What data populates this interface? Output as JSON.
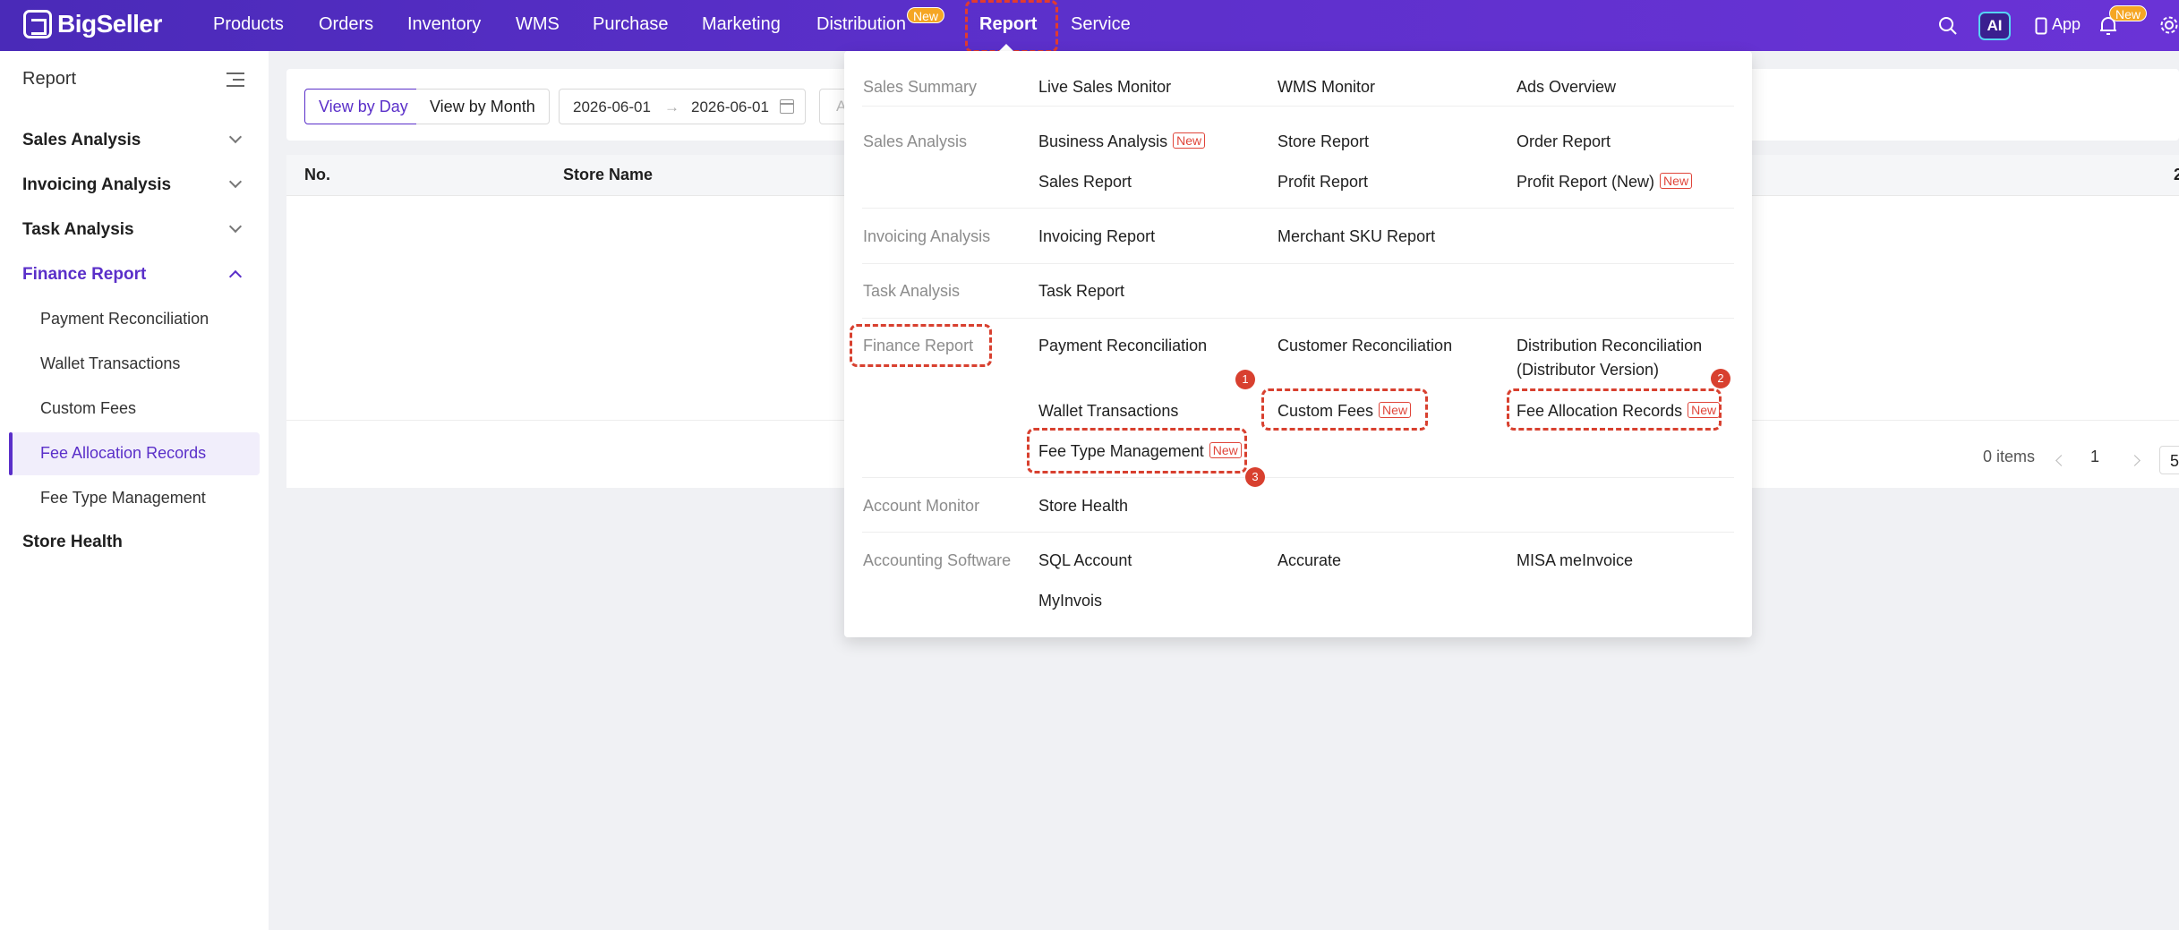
{
  "brand": {
    "name": "BigSeller"
  },
  "nav": {
    "items": [
      "Products",
      "Orders",
      "Inventory",
      "WMS",
      "Purchase",
      "Marketing",
      "Distribution",
      "Report",
      "Service"
    ],
    "distribution_badge": "New",
    "active": "Report"
  },
  "top_right": {
    "ai": "AI",
    "app": "App",
    "notif_badge": "New"
  },
  "sidebar": {
    "title": "Report",
    "groups": {
      "sales_analysis": "Sales Analysis",
      "invoicing_analysis": "Invoicing Analysis",
      "task_analysis": "Task Analysis",
      "finance_report": "Finance Report",
      "store_health": "Store Health"
    },
    "finance_items": [
      "Payment Reconciliation",
      "Wallet Transactions",
      "Custom Fees",
      "Fee Allocation Records",
      "Fee Type Management"
    ],
    "selected": "Fee Allocation Records"
  },
  "filters": {
    "view_by_day": "View by Day",
    "view_by_month": "View by Month",
    "date_from": "2026-06-01",
    "date_to": "2026-06-01",
    "arrow": "→",
    "next_field_initial": "A"
  },
  "table": {
    "columns": [
      "No.",
      "Store Name"
    ],
    "right_edge_text": "2"
  },
  "pagination": {
    "items_text": "0 items",
    "current_page": "1",
    "page_size_partial": "5"
  },
  "dropdown": {
    "categories": {
      "sales_summary": "Sales Summary",
      "sales_analysis": "Sales Analysis",
      "invoicing_analysis": "Invoicing Analysis",
      "task_analysis": "Task Analysis",
      "finance_report": "Finance Report",
      "account_monitor": "Account Monitor",
      "accounting_software": "Accounting Software"
    },
    "links": {
      "live_sales_monitor": "Live Sales Monitor",
      "wms_monitor": "WMS Monitor",
      "ads_overview": "Ads Overview",
      "business_analysis": "Business Analysis",
      "store_report": "Store Report",
      "order_report": "Order Report",
      "sales_report": "Sales Report",
      "profit_report": "Profit Report",
      "profit_report_new": "Profit Report (New)",
      "invoicing_report": "Invoicing Report",
      "merchant_sku_report": "Merchant SKU Report",
      "task_report": "Task Report",
      "payment_reconciliation": "Payment Reconciliation",
      "customer_reconciliation": "Customer Reconciliation",
      "distribution_reconciliation_1": "Distribution Reconciliation",
      "distribution_reconciliation_2": "(Distributor Version)",
      "wallet_transactions": "Wallet Transactions",
      "custom_fees": "Custom Fees",
      "fee_allocation_records": "Fee Allocation Records",
      "fee_type_management": "Fee Type Management",
      "store_health": "Store Health",
      "sql_account": "SQL Account",
      "accurate": "Accurate",
      "misa_meinvoice": "MISA meInvoice",
      "myinvois": "MyInvois"
    },
    "new_tag": "New",
    "callouts": [
      "1",
      "2",
      "3"
    ]
  },
  "colors": {
    "brand": "#5a2fc9",
    "highlight": "#d8402f",
    "badge": "#f5a623"
  }
}
